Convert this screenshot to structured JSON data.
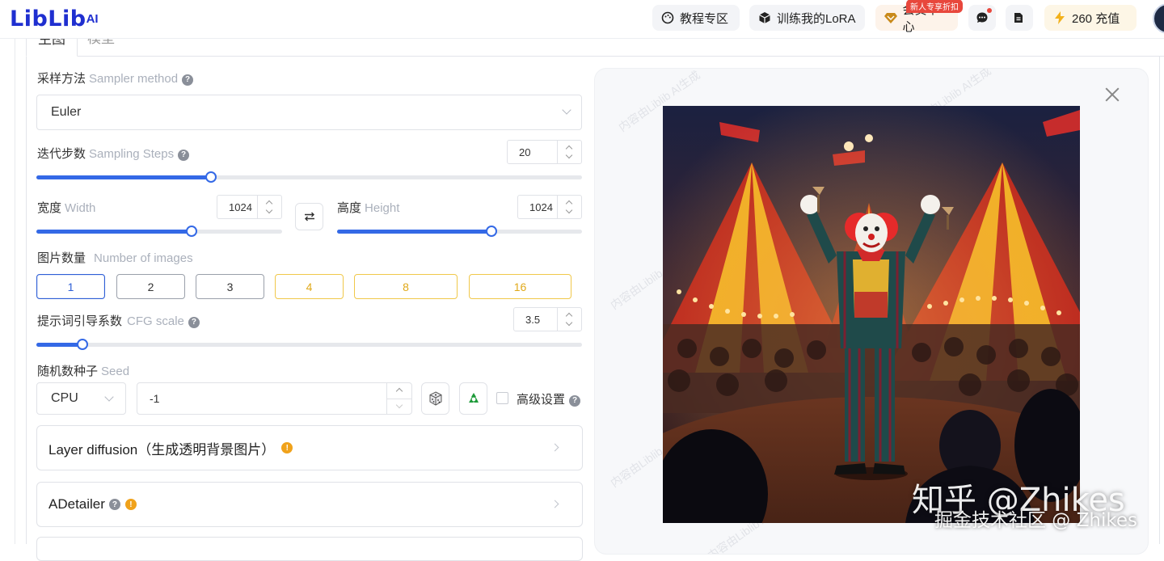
{
  "header": {
    "logo": "LibLib",
    "logo_ai": "AI",
    "tutorial_label": "教程专区",
    "train_label": "训练我的LoRA",
    "member_label": "会员中心",
    "member_badge": "新人专享折扣",
    "recharge_label": "260 充值",
    "accent": "#1f2fd0"
  },
  "tabs": {
    "active": "生图",
    "second": "模型"
  },
  "sampler": {
    "label": "采样方法",
    "label_en": "Sampler method",
    "value": "Euler"
  },
  "steps": {
    "label": "迭代步数",
    "label_en": "Sampling Steps",
    "value": "20",
    "fraction": 0.32
  },
  "width": {
    "label": "宽度",
    "label_en": "Width",
    "value": "1024",
    "fraction": 0.63
  },
  "height": {
    "label": "高度",
    "label_en": "Height",
    "value": "1024",
    "fraction": 0.63
  },
  "images": {
    "label": "图片数量",
    "label_en": "Number of images",
    "options": [
      "1",
      "2",
      "3",
      "4",
      "8",
      "16"
    ],
    "selected": "1"
  },
  "cfg": {
    "label": "提示词引导系数",
    "label_en": "CFG scale",
    "value": "3.5",
    "fraction": 0.085
  },
  "seed": {
    "label": "随机数种子",
    "label_en": "Seed",
    "device": "CPU",
    "value": "-1",
    "advanced_label": "高级设置"
  },
  "panels": {
    "layer_diffusion": "Layer diffusion（生成透明背景图片）",
    "adetailer": "ADetailer"
  },
  "watermarks": {
    "zhihu": "知乎 @Zhikes",
    "juejin": "掘金技术社区 @ Zhikes",
    "preview_mark": "内容由Liblib AI生成"
  }
}
